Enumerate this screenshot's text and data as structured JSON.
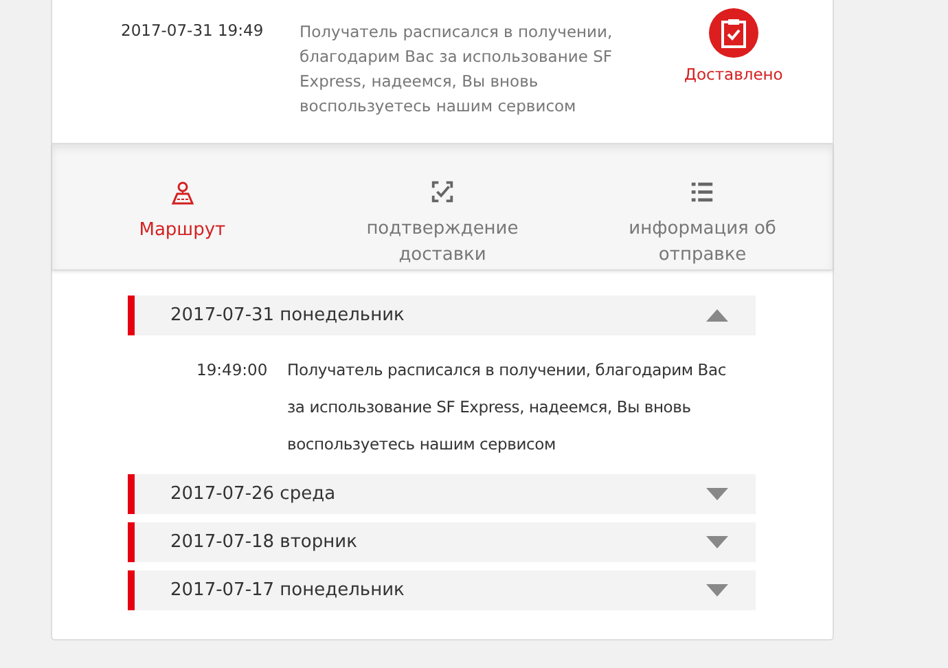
{
  "latest": {
    "time": "2017-07-31 19:49",
    "message": "Получатель расписался в получении, благодарим Вас за использование SF Express, надеемся, Вы вновь воспользуетесь нашим сервисом",
    "status": "Доставлено"
  },
  "tabs": [
    {
      "label": "Маршрут",
      "kind": "route",
      "selected": true
    },
    {
      "label": "подтверждение доставки",
      "kind": "confirm",
      "selected": false
    },
    {
      "label": "информация об отправке",
      "kind": "info",
      "selected": false
    }
  ],
  "days": [
    {
      "date": "2017-07-31 понедельник",
      "expanded": true,
      "events": [
        {
          "time": "19:49:00",
          "text": "Получатель расписался в получении, благодарим Вас за использование SF Express, надеемся, Вы вновь воспользуетесь нашим сервисом"
        }
      ]
    },
    {
      "date": "2017-07-26 среда",
      "expanded": false
    },
    {
      "date": "2017-07-18 вторник",
      "expanded": false
    },
    {
      "date": "2017-07-17 понедельник",
      "expanded": false
    }
  ]
}
